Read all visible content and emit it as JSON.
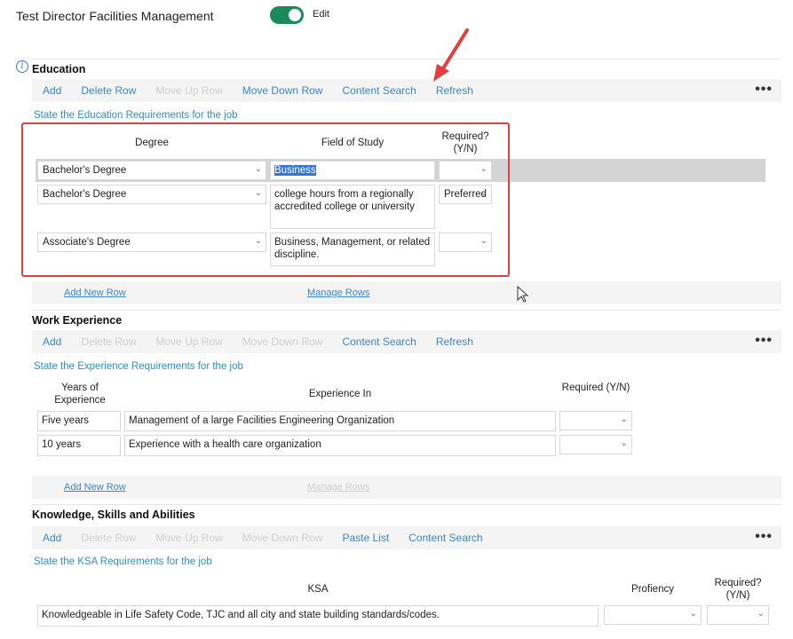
{
  "header": {
    "title": "Test Director Facilities Management",
    "edit_label": "Edit",
    "edit_toggle_on": true,
    "toggle_color": "#1a8a5a"
  },
  "info_icon": "info-icon",
  "education": {
    "title": "Education",
    "toolbar": {
      "add": "Add",
      "delete_row": "Delete Row",
      "move_up_row": "Move Up Row",
      "move_down_row": "Move Down Row",
      "content_search": "Content Search",
      "refresh": "Refresh",
      "more": "•••"
    },
    "instruction": "State the Education Requirements for the job",
    "columns": {
      "degree": "Degree",
      "field_of_study": "Field of Study",
      "required": "Required? (Y/N)"
    },
    "rows": [
      {
        "degree": "Bachelor's Degree",
        "field": "Business",
        "required": ""
      },
      {
        "degree": "Bachelor's Degree",
        "field": "college hours from a regionally accredited college or university",
        "required": "Preferred"
      },
      {
        "degree": "Associate's Degree",
        "field": "Business, Management, or related discipline.",
        "required": ""
      }
    ],
    "footer": {
      "add_new_row": "Add New Row",
      "manage_rows": "Manage Rows"
    }
  },
  "work_experience": {
    "title": "Work Experience",
    "toolbar": {
      "add": "Add",
      "delete_row": "Delete Row",
      "move_up_row": "Move Up Row",
      "move_down_row": "Move Down Row",
      "content_search": "Content Search",
      "refresh": "Refresh",
      "more": "•••"
    },
    "instruction": "State the Experience Requirements for the job",
    "columns": {
      "years": "Years of Experience",
      "experience_in": "Experience In",
      "required": "Required (Y/N)"
    },
    "rows": [
      {
        "years": "Five years",
        "experience": "Management of a large Facilities Engineering Organization",
        "required": ""
      },
      {
        "years": "10 years",
        "experience": "Experience with a health care organization",
        "required": ""
      }
    ],
    "footer": {
      "add_new_row": "Add New Row",
      "manage_rows": "Manage Rows"
    }
  },
  "ksa": {
    "title": "Knowledge, Skills and Abilities",
    "toolbar": {
      "add": "Add",
      "delete_row": "Delete Row",
      "move_up_row": "Move Up Row",
      "move_down_row": "Move Down Row",
      "paste_list": "Paste List",
      "content_search": "Content Search",
      "more": "•••"
    },
    "instruction": "State the KSA Requirements for the job",
    "columns": {
      "ksa": "KSA",
      "proficiency": "Profiency",
      "required": "Required? (Y/N)"
    },
    "rows": [
      {
        "ksa": "Knowledgeable in Life Safety Code, TJC and all city and state building standards/codes.",
        "proficiency": "",
        "required": ""
      }
    ]
  },
  "colors": {
    "link": "#3b86c4",
    "disabled": "#cfcfcf",
    "instruction": "#2f8fbf",
    "annotation_red": "#e04040",
    "selection_blue": "#3a73d9"
  }
}
